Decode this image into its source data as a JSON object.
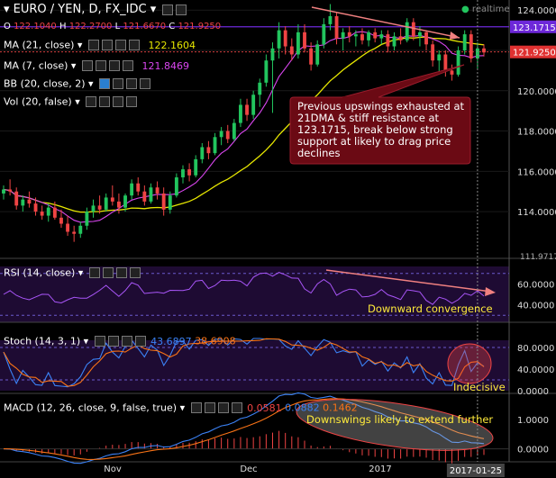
{
  "header": {
    "title": "EURO / YEN, D, FX_IDC",
    "ohlc": {
      "o_label": "O",
      "o": "122.1040",
      "h_label": "H",
      "h": "122.2700",
      "l_label": "L",
      "l": "121.6670",
      "c_label": "C",
      "c": "121.9250"
    },
    "status": "realtime"
  },
  "indicators": {
    "ma21": {
      "label": "MA (21, close)",
      "value": "122.1604"
    },
    "ma7": {
      "label": "MA (7, close)",
      "value": "121.8469"
    },
    "bb": {
      "label": "BB (20, close, 2)"
    },
    "vol": {
      "label": "Vol (20, false)"
    },
    "rsi": {
      "label": "RSI (14, close)"
    },
    "stoch": {
      "label": "Stoch (14, 3, 1)",
      "k": "43.6897",
      "d": "38.6908"
    },
    "macd": {
      "label": "MACD (12, 26, close, 9, false, true)",
      "v1": "0.0581",
      "v2": "0.0882",
      "v3": "0.1462"
    }
  },
  "price_axis": {
    "ticks": [
      "124.0000",
      "122.0000",
      "120.0000",
      "118.0000",
      "116.0000",
      "114.0000"
    ],
    "resistance_label": "123.1715",
    "last_price_label": "121.9250",
    "cut_label": "111.9717"
  },
  "rsi_axis": {
    "ticks": [
      "60.0000",
      "40.0000"
    ]
  },
  "stoch_axis": {
    "ticks": [
      "80.0000",
      "40.0000",
      "0.0000"
    ]
  },
  "macd_axis": {
    "ticks": [
      "1.0000",
      "0.0000"
    ]
  },
  "time_axis": {
    "labels": [
      "Nov",
      "Dec",
      "2017"
    ],
    "cursor_date": "2017-01-25"
  },
  "annotations": {
    "main": "Previous upswings exhausted at 21DMA & stiff resistance at 123.1715, break below strong support at likely to drag price declines",
    "rsi": "Downward convergence",
    "stoch": "Indecisive",
    "macd": "Downswings likely to extend further"
  },
  "colors": {
    "up": "#22c55e",
    "down": "#ef4444",
    "ma21": "#e6e600",
    "ma7": "#d946ef",
    "rsi": "#a855f7",
    "stoch_k": "#3b82f6",
    "stoch_d": "#f97316",
    "macd": "#3b82f6",
    "signal": "#f97316",
    "resistance": "#6d28d9",
    "callout": "#6b0a14"
  },
  "chart_data": {
    "type": "candlestick",
    "title": "EURO / YEN, D, FX_IDC",
    "x_range": [
      "2016-10-10",
      "2017-01-25"
    ],
    "price_ylim": [
      111.97,
      124.4
    ],
    "resistance": 123.1715,
    "candles": [
      {
        "o": 114.9,
        "h": 115.3,
        "l": 114.6,
        "c": 115.1
      },
      {
        "o": 115.1,
        "h": 115.6,
        "l": 114.8,
        "c": 115.0
      },
      {
        "o": 115.0,
        "h": 115.2,
        "l": 114.1,
        "c": 114.3
      },
      {
        "o": 114.3,
        "h": 114.8,
        "l": 114.0,
        "c": 114.6
      },
      {
        "o": 114.6,
        "h": 115.0,
        "l": 114.2,
        "c": 114.4
      },
      {
        "o": 114.4,
        "h": 114.7,
        "l": 113.8,
        "c": 114.0
      },
      {
        "o": 114.0,
        "h": 114.3,
        "l": 113.6,
        "c": 113.8
      },
      {
        "o": 113.8,
        "h": 114.4,
        "l": 113.5,
        "c": 114.2
      },
      {
        "o": 114.2,
        "h": 114.5,
        "l": 113.6,
        "c": 113.7
      },
      {
        "o": 113.7,
        "h": 114.1,
        "l": 113.2,
        "c": 113.4
      },
      {
        "o": 113.4,
        "h": 113.8,
        "l": 112.8,
        "c": 113.0
      },
      {
        "o": 113.0,
        "h": 113.3,
        "l": 112.5,
        "c": 112.9
      },
      {
        "o": 112.9,
        "h": 113.5,
        "l": 112.7,
        "c": 113.3
      },
      {
        "o": 113.3,
        "h": 114.2,
        "l": 113.1,
        "c": 114.0
      },
      {
        "o": 114.0,
        "h": 114.6,
        "l": 113.7,
        "c": 114.3
      },
      {
        "o": 114.3,
        "h": 114.8,
        "l": 113.9,
        "c": 114.1
      },
      {
        "o": 114.1,
        "h": 114.9,
        "l": 114.0,
        "c": 114.7
      },
      {
        "o": 114.7,
        "h": 115.3,
        "l": 114.3,
        "c": 114.5
      },
      {
        "o": 114.5,
        "h": 114.9,
        "l": 113.9,
        "c": 114.2
      },
      {
        "o": 114.2,
        "h": 114.9,
        "l": 114.0,
        "c": 114.8
      },
      {
        "o": 114.8,
        "h": 115.6,
        "l": 114.6,
        "c": 115.4
      },
      {
        "o": 115.4,
        "h": 115.7,
        "l": 114.8,
        "c": 115.0
      },
      {
        "o": 115.0,
        "h": 115.3,
        "l": 114.3,
        "c": 114.5
      },
      {
        "o": 114.5,
        "h": 115.4,
        "l": 114.4,
        "c": 115.2
      },
      {
        "o": 115.2,
        "h": 115.5,
        "l": 114.6,
        "c": 114.9
      },
      {
        "o": 114.9,
        "h": 115.2,
        "l": 113.8,
        "c": 114.1
      },
      {
        "o": 114.1,
        "h": 115.0,
        "l": 113.9,
        "c": 114.8
      },
      {
        "o": 114.8,
        "h": 115.9,
        "l": 114.7,
        "c": 115.7
      },
      {
        "o": 115.7,
        "h": 116.3,
        "l": 115.4,
        "c": 116.1
      },
      {
        "o": 116.1,
        "h": 116.4,
        "l": 115.5,
        "c": 115.8
      },
      {
        "o": 115.8,
        "h": 116.8,
        "l": 115.7,
        "c": 116.6
      },
      {
        "o": 116.6,
        "h": 117.4,
        "l": 116.4,
        "c": 117.2
      },
      {
        "o": 117.2,
        "h": 117.5,
        "l": 116.6,
        "c": 116.9
      },
      {
        "o": 116.9,
        "h": 117.9,
        "l": 116.8,
        "c": 117.7
      },
      {
        "o": 117.7,
        "h": 118.2,
        "l": 117.3,
        "c": 118.0
      },
      {
        "o": 118.0,
        "h": 118.3,
        "l": 117.4,
        "c": 117.6
      },
      {
        "o": 117.6,
        "h": 118.6,
        "l": 117.5,
        "c": 118.4
      },
      {
        "o": 118.4,
        "h": 119.6,
        "l": 118.2,
        "c": 119.3
      },
      {
        "o": 119.3,
        "h": 119.6,
        "l": 118.5,
        "c": 118.8
      },
      {
        "o": 118.8,
        "h": 120.0,
        "l": 118.6,
        "c": 119.8
      },
      {
        "o": 119.8,
        "h": 120.6,
        "l": 119.2,
        "c": 120.4
      },
      {
        "o": 120.4,
        "h": 121.8,
        "l": 120.2,
        "c": 121.5
      },
      {
        "o": 121.5,
        "h": 122.4,
        "l": 118.9,
        "c": 122.1
      },
      {
        "o": 122.1,
        "h": 123.4,
        "l": 121.6,
        "c": 123.0
      },
      {
        "o": 123.0,
        "h": 123.2,
        "l": 121.8,
        "c": 122.2
      },
      {
        "o": 122.2,
        "h": 122.6,
        "l": 121.5,
        "c": 121.8
      },
      {
        "o": 121.8,
        "h": 123.3,
        "l": 121.6,
        "c": 122.9
      },
      {
        "o": 122.9,
        "h": 123.3,
        "l": 121.9,
        "c": 122.1
      },
      {
        "o": 122.1,
        "h": 122.4,
        "l": 121.0,
        "c": 121.3
      },
      {
        "o": 121.3,
        "h": 122.5,
        "l": 121.2,
        "c": 122.3
      },
      {
        "o": 122.3,
        "h": 123.6,
        "l": 122.1,
        "c": 123.3
      },
      {
        "o": 123.3,
        "h": 124.3,
        "l": 123.0,
        "c": 123.7
      },
      {
        "o": 123.7,
        "h": 123.9,
        "l": 122.3,
        "c": 122.6
      },
      {
        "o": 122.6,
        "h": 123.1,
        "l": 122.0,
        "c": 122.9
      },
      {
        "o": 122.9,
        "h": 123.2,
        "l": 122.4,
        "c": 122.7
      },
      {
        "o": 122.7,
        "h": 123.0,
        "l": 122.2,
        "c": 122.8
      },
      {
        "o": 122.8,
        "h": 123.1,
        "l": 122.3,
        "c": 122.5
      },
      {
        "o": 122.5,
        "h": 123.0,
        "l": 122.2,
        "c": 122.9
      },
      {
        "o": 122.9,
        "h": 123.1,
        "l": 122.4,
        "c": 122.6
      },
      {
        "o": 122.6,
        "h": 123.0,
        "l": 122.3,
        "c": 122.8
      },
      {
        "o": 122.8,
        "h": 123.0,
        "l": 121.9,
        "c": 122.2
      },
      {
        "o": 122.2,
        "h": 122.9,
        "l": 122.0,
        "c": 122.7
      },
      {
        "o": 122.7,
        "h": 123.1,
        "l": 122.3,
        "c": 122.5
      },
      {
        "o": 122.5,
        "h": 123.6,
        "l": 122.4,
        "c": 123.4
      },
      {
        "o": 123.4,
        "h": 123.6,
        "l": 122.5,
        "c": 122.7
      },
      {
        "o": 122.7,
        "h": 123.2,
        "l": 122.2,
        "c": 122.9
      },
      {
        "o": 122.9,
        "h": 123.0,
        "l": 122.0,
        "c": 122.3
      },
      {
        "o": 122.3,
        "h": 122.5,
        "l": 121.2,
        "c": 121.5
      },
      {
        "o": 121.5,
        "h": 122.0,
        "l": 120.9,
        "c": 121.8
      },
      {
        "o": 121.8,
        "h": 122.0,
        "l": 120.7,
        "c": 121.0
      },
      {
        "o": 121.0,
        "h": 121.3,
        "l": 120.5,
        "c": 120.8
      },
      {
        "o": 120.8,
        "h": 122.2,
        "l": 120.7,
        "c": 122.0
      },
      {
        "o": 122.0,
        "h": 123.0,
        "l": 121.8,
        "c": 122.8
      },
      {
        "o": 122.8,
        "h": 123.0,
        "l": 121.4,
        "c": 121.6
      },
      {
        "o": 121.6,
        "h": 122.4,
        "l": 121.1,
        "c": 122.1
      },
      {
        "o": 122.1,
        "h": 122.3,
        "l": 121.7,
        "c": 121.9
      }
    ]
  }
}
